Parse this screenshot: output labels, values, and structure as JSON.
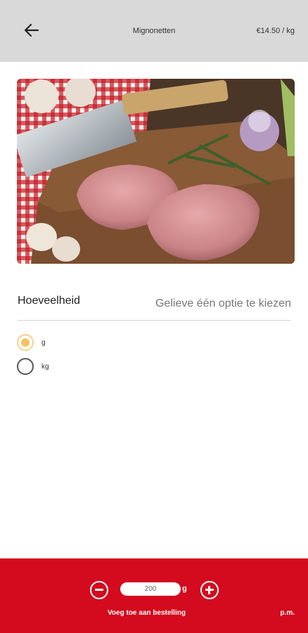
{
  "header": {
    "back_icon": "arrow-left-icon",
    "title": "Mignonetten",
    "price": "€14.50 / kg"
  },
  "product_image": {
    "content": "photo of raw pork medallions on a wooden cutting board with a cleaver, rosemary, garlic and turnip"
  },
  "quantity": {
    "label": "Hoeveelheid",
    "placeholder": "Gelieve één optie te kiezen",
    "options": [
      {
        "label": "g",
        "selected": true
      },
      {
        "label": "kg",
        "selected": false
      }
    ]
  },
  "footer": {
    "minus_icon": "minus-circle-icon",
    "plus_icon": "plus-circle-icon",
    "amount_value": "200",
    "unit": "g",
    "add_label": "Voeg toe aan bestelling",
    "total": "p.m."
  },
  "colors": {
    "header_bg": "#d9d9d9",
    "footer_bg": "#d40a1e",
    "radio_selected": "#f7c35f"
  }
}
